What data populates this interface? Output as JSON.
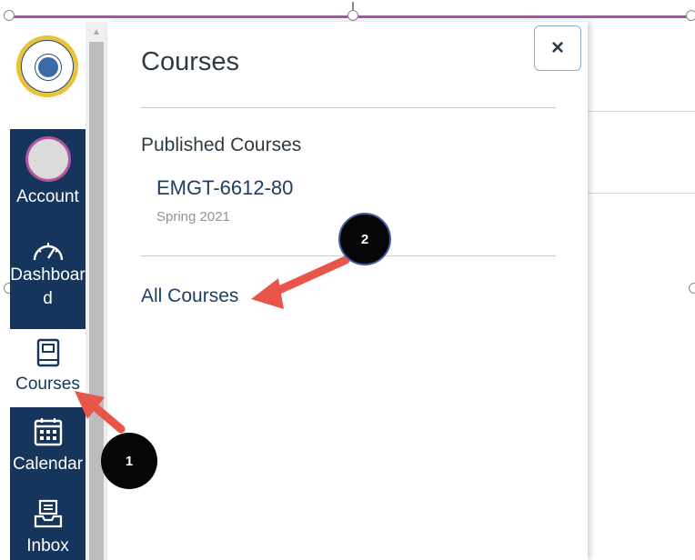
{
  "global_nav": {
    "account_label": "Account",
    "dashboard_label_line1": "Dashboar",
    "dashboard_label_line2": "d",
    "courses_label": "Courses",
    "calendar_label": "Calendar",
    "inbox_label": "Inbox",
    "logo_icon": "university-seal-logo",
    "colors": {
      "nav_bg": "#15355c",
      "active_bg": "#ffffff",
      "avatar_ring": "#b2559b"
    }
  },
  "tray": {
    "title": "Courses",
    "close_label": "×",
    "section_heading": "Published Courses",
    "courses": [
      {
        "name": "EMGT-6612-80",
        "term": "Spring 2021"
      }
    ],
    "all_courses_label": "All Courses"
  },
  "annotations": {
    "badge_1": "1",
    "badge_2": "2",
    "arrow_color": "#e8564a"
  }
}
